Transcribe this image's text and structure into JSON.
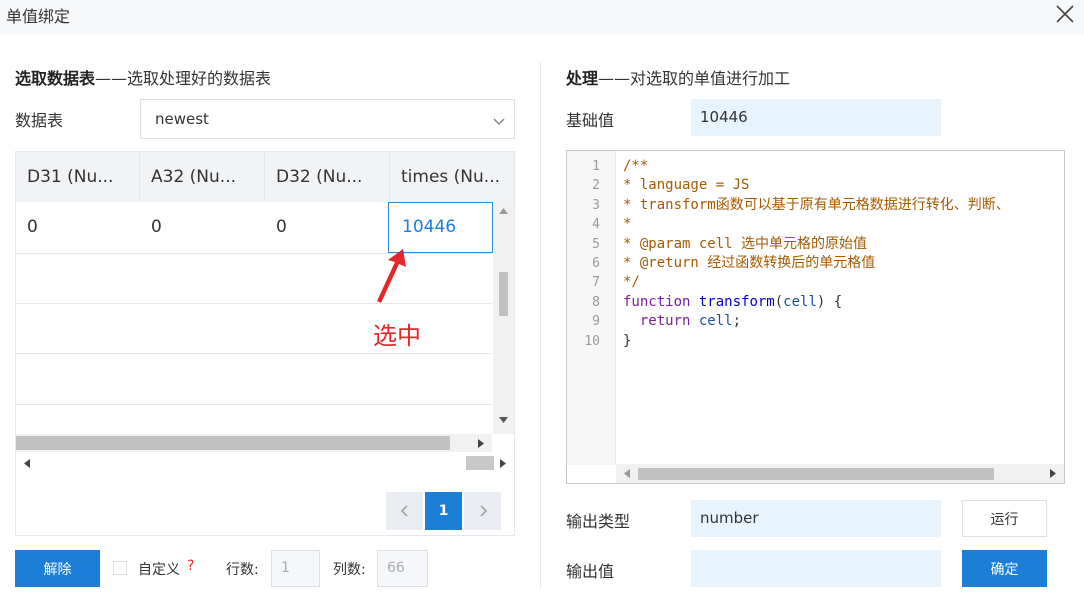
{
  "window": {
    "title": "单值绑定"
  },
  "left": {
    "section_title_bold": "选取数据表",
    "section_title_rest": "——选取处理好的数据表",
    "table_label": "数据表",
    "table_select_value": "newest",
    "grid": {
      "columns": [
        "D31 (Nu...",
        "A32 (Nu...",
        "D32 (Nu...",
        "times (Nu..."
      ],
      "rows": [
        [
          "0",
          "0",
          "0",
          "10446"
        ]
      ]
    },
    "annotation": "选中",
    "pagination": {
      "current": "1"
    },
    "unbind_button": "解除",
    "custom_label": "自定义",
    "help_mark": "?",
    "rows_label": "行数:",
    "rows_value": "1",
    "cols_label": "列数:",
    "cols_value": "66"
  },
  "right": {
    "section_title_bold": "处理",
    "section_title_rest": "——对选取的单值进行加工",
    "base_label": "基础值",
    "base_value": "10446",
    "code": {
      "line_numbers": [
        "1",
        "2",
        "3",
        "4",
        "5",
        "6",
        "7",
        "8",
        "9",
        "10"
      ],
      "l1": "/**",
      "l2": "* language = JS",
      "l3": "* transform函数可以基于原有单元格数据进行转化、判断、",
      "l4": "*",
      "l5": "* @param cell 选中单元格的原始值",
      "l6": "* @return 经过函数转换后的单元格值",
      "l7": "*/",
      "l8_kw": "function",
      "l8_fn": "transform",
      "l8_open": "(",
      "l8_arg": "cell",
      "l8_close": ") {",
      "l9_kw": "return",
      "l9_var": "cell",
      "l9_end": ";",
      "l10": "}"
    },
    "output_type_label": "输出类型",
    "output_type_value": "number",
    "run_button": "运行",
    "output_value_label": "输出值",
    "output_value": "",
    "confirm_button": "确定"
  }
}
